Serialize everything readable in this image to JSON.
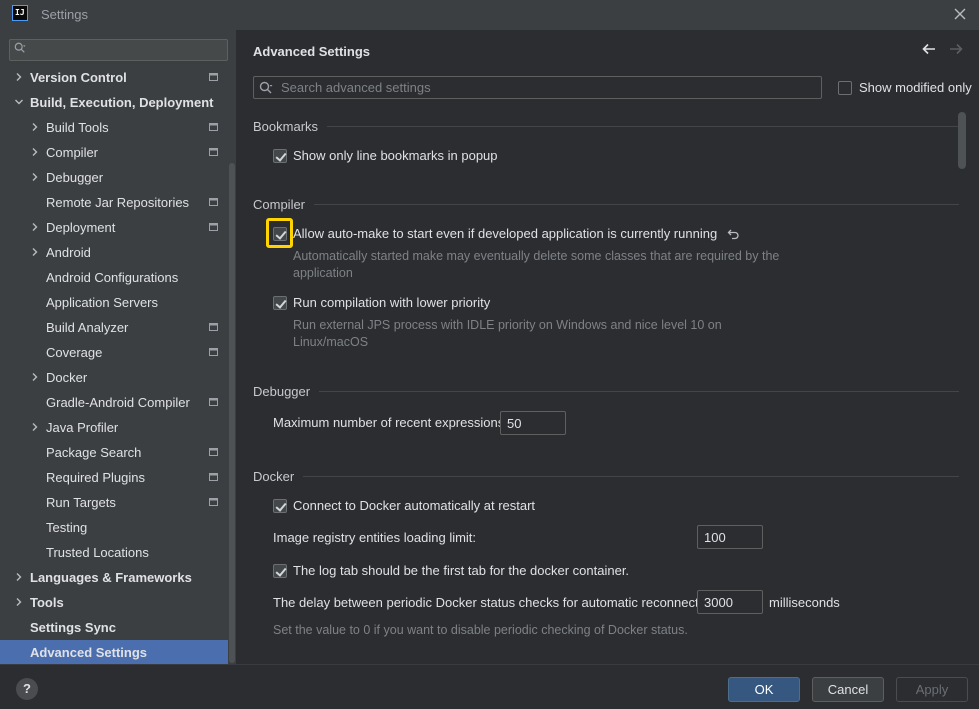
{
  "window": {
    "title": "Settings",
    "app_icon": "IJ"
  },
  "sidebar": {
    "search_placeholder": "",
    "items": [
      {
        "label": "Version Control",
        "level": 0,
        "expandable": true,
        "expanded": false,
        "bold": true,
        "project_icon": true
      },
      {
        "label": "Build, Execution, Deployment",
        "level": 0,
        "expandable": true,
        "expanded": true,
        "bold": true,
        "project_icon": false
      },
      {
        "label": "Build Tools",
        "level": 1,
        "expandable": true,
        "expanded": false,
        "bold": false,
        "project_icon": true
      },
      {
        "label": "Compiler",
        "level": 1,
        "expandable": true,
        "expanded": false,
        "bold": false,
        "project_icon": true
      },
      {
        "label": "Debugger",
        "level": 1,
        "expandable": true,
        "expanded": false,
        "bold": false,
        "project_icon": false
      },
      {
        "label": "Remote Jar Repositories",
        "level": 1,
        "expandable": false,
        "expanded": false,
        "bold": false,
        "project_icon": true
      },
      {
        "label": "Deployment",
        "level": 1,
        "expandable": true,
        "expanded": false,
        "bold": false,
        "project_icon": true
      },
      {
        "label": "Android",
        "level": 1,
        "expandable": true,
        "expanded": false,
        "bold": false,
        "project_icon": false
      },
      {
        "label": "Android Configurations",
        "level": 1,
        "expandable": false,
        "expanded": false,
        "bold": false,
        "project_icon": false
      },
      {
        "label": "Application Servers",
        "level": 1,
        "expandable": false,
        "expanded": false,
        "bold": false,
        "project_icon": false
      },
      {
        "label": "Build Analyzer",
        "level": 1,
        "expandable": false,
        "expanded": false,
        "bold": false,
        "project_icon": true
      },
      {
        "label": "Coverage",
        "level": 1,
        "expandable": false,
        "expanded": false,
        "bold": false,
        "project_icon": true
      },
      {
        "label": "Docker",
        "level": 1,
        "expandable": true,
        "expanded": false,
        "bold": false,
        "project_icon": false
      },
      {
        "label": "Gradle-Android Compiler",
        "level": 1,
        "expandable": false,
        "expanded": false,
        "bold": false,
        "project_icon": true
      },
      {
        "label": "Java Profiler",
        "level": 1,
        "expandable": true,
        "expanded": false,
        "bold": false,
        "project_icon": false
      },
      {
        "label": "Package Search",
        "level": 1,
        "expandable": false,
        "expanded": false,
        "bold": false,
        "project_icon": true
      },
      {
        "label": "Required Plugins",
        "level": 1,
        "expandable": false,
        "expanded": false,
        "bold": false,
        "project_icon": true
      },
      {
        "label": "Run Targets",
        "level": 1,
        "expandable": false,
        "expanded": false,
        "bold": false,
        "project_icon": true
      },
      {
        "label": "Testing",
        "level": 1,
        "expandable": false,
        "expanded": false,
        "bold": false,
        "project_icon": false
      },
      {
        "label": "Trusted Locations",
        "level": 1,
        "expandable": false,
        "expanded": false,
        "bold": false,
        "project_icon": false
      },
      {
        "label": "Languages & Frameworks",
        "level": 0,
        "expandable": true,
        "expanded": false,
        "bold": true,
        "project_icon": false
      },
      {
        "label": "Tools",
        "level": 0,
        "expandable": true,
        "expanded": false,
        "bold": true,
        "project_icon": false
      },
      {
        "label": "Settings Sync",
        "level": 0,
        "expandable": false,
        "expanded": false,
        "bold": true,
        "project_icon": false
      },
      {
        "label": "Advanced Settings",
        "level": 0,
        "expandable": false,
        "expanded": false,
        "bold": true,
        "project_icon": false,
        "selected": true
      }
    ]
  },
  "main": {
    "title": "Advanced Settings",
    "search_placeholder": "Search advanced settings",
    "show_modified_label": "Show modified only",
    "show_modified_checked": false,
    "sections": {
      "bookmarks": {
        "title": "Bookmarks",
        "line_bookmarks_label": "Show only line bookmarks in popup",
        "line_bookmarks_checked": true
      },
      "compiler": {
        "title": "Compiler",
        "auto_make_label": "Allow auto-make to start even if developed application is currently running",
        "auto_make_checked": true,
        "auto_make_hint": "Automatically started make may eventually delete some classes that are required by the application",
        "low_priority_label": "Run compilation with lower priority",
        "low_priority_checked": true,
        "low_priority_hint": "Run external JPS process with IDLE priority on Windows and nice level 10 on Linux/macOS"
      },
      "debugger": {
        "title": "Debugger",
        "recent_expr_label": "Maximum number of recent expressions:",
        "recent_expr_value": "50"
      },
      "docker": {
        "title": "Docker",
        "auto_connect_label": "Connect to Docker automatically at restart",
        "auto_connect_checked": true,
        "registry_limit_label": "Image registry entities loading limit:",
        "registry_limit_value": "100",
        "log_tab_label": "The log tab should be the first tab for the docker container.",
        "log_tab_checked": true,
        "delay_label": "The delay between periodic Docker status checks for automatic reconnection:",
        "delay_value": "3000",
        "delay_unit": "milliseconds",
        "delay_hint": "Set the value to 0 if you want to disable periodic checking of Docker status."
      }
    }
  },
  "footer": {
    "help_label": "?",
    "ok_label": "OK",
    "cancel_label": "Cancel",
    "apply_label": "Apply",
    "apply_enabled": false
  },
  "colors": {
    "accent_selected": "#4b6eaf",
    "ok_button": "#365880",
    "highlight": "#ffd400"
  }
}
